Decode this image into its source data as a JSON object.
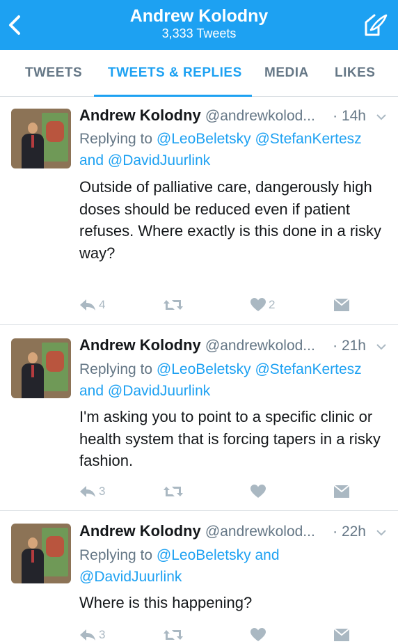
{
  "header": {
    "title": "Andrew Kolodny",
    "subtitle": "3,333 Tweets",
    "back_icon": "chevron-left-icon",
    "compose_icon": "compose-tweet-icon"
  },
  "tabs": [
    {
      "label": "TWEETS"
    },
    {
      "label": "TWEETS & REPLIES"
    },
    {
      "label": "MEDIA"
    },
    {
      "label": "LIKES"
    }
  ],
  "active_tab": "TWEETS & REPLIES",
  "colors": {
    "accent": "#1da1f2",
    "muted": "#657786",
    "icon": "#aab8c2"
  },
  "tweets": [
    {
      "name": "Andrew Kolodny",
      "handle": "@andrewkolod...",
      "time": "· 14h",
      "replying_prefix": "Replying to",
      "mentions_line1": "@LeoBeletsky @StefanKertesz",
      "and_word": "and",
      "mentions_line2": "@DavidJuurlink",
      "text": "Outside of palliative care, dangerously high doses should be reduced even if patient refuses. Where exactly is this done in a risky way?",
      "reply_count": "4",
      "like_count": "2"
    },
    {
      "name": "Andrew Kolodny",
      "handle": "@andrewkolod...",
      "time": "· 21h",
      "replying_prefix": "Replying to",
      "mentions_line1": "@LeoBeletsky @StefanKertesz",
      "and_word": "and",
      "mentions_line2": "@DavidJuurlink",
      "text": "I'm asking you to point to a specific clinic or health system that is  forcing tapers in a risky fashion.",
      "reply_count": "3",
      "like_count": ""
    },
    {
      "name": "Andrew Kolodny",
      "handle": "@andrewkolod...",
      "time": "· 22h",
      "replying_prefix": "Replying to",
      "mentions_line1": "@LeoBeletsky",
      "and_word": "and",
      "mentions_line2": "@DavidJuurlink",
      "text": "Where is this happening?",
      "reply_count": "3",
      "like_count": ""
    }
  ]
}
